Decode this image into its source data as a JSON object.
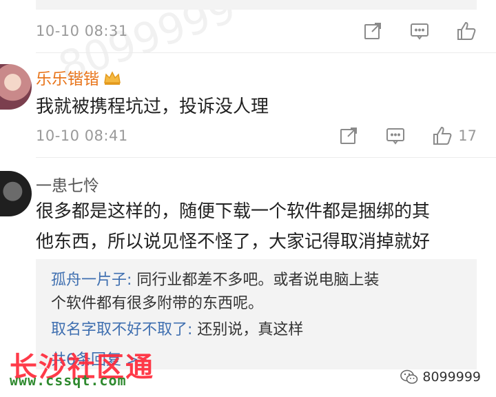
{
  "top_comment": {
    "timestamp": "10-10 08:31"
  },
  "comments": [
    {
      "username": "乐乐锴锴",
      "text": "我就被携程坑过，投诉没人理",
      "timestamp": "10-10 08:41",
      "like_count": "17"
    },
    {
      "username": "一患七怜",
      "text_line1": "很多都是这样的，随便下载一个软件都是捆绑的其",
      "text_line2": "他东西，所以说见怪不怪了，大家记得取消掉就好"
    }
  ],
  "replies": [
    {
      "name": "孤舟一片子:",
      "line1": " 同行业都差不多吧。或者说电脑上装",
      "line2": "个软件都有很多附带的东西呢。"
    },
    {
      "name": "取名字取不好不取了:",
      "line1": " 还别说，真这样"
    }
  ],
  "reply_more": "共6条回复 >",
  "watermarks": {
    "site_name": "长沙社区通",
    "site_url": "www.cssqt.com",
    "wechat_id": "8099999",
    "faint": "8099999"
  },
  "colors": {
    "vip_name": "#e8741a",
    "reply_name": "#3f6fb0",
    "watermark_red": "#ff2a3a"
  }
}
